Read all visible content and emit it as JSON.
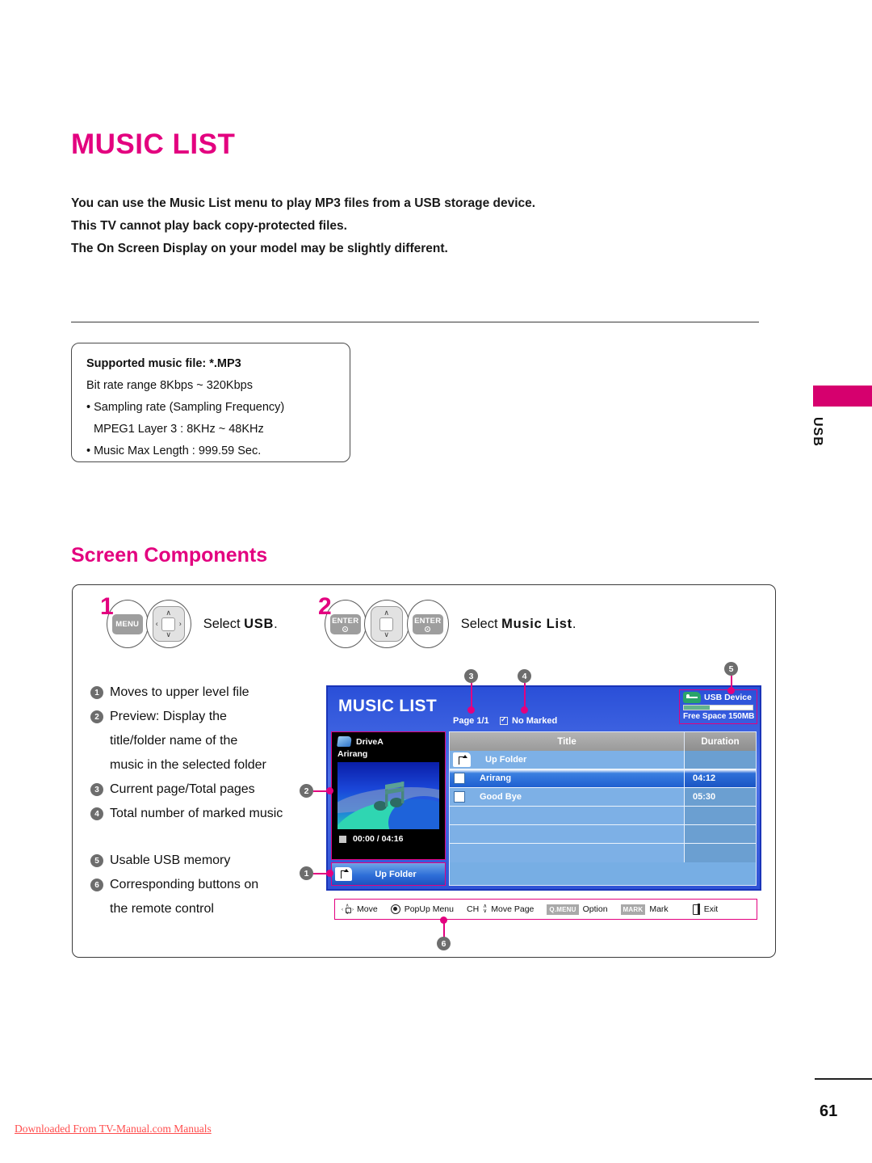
{
  "page": {
    "title": "MUSIC LIST",
    "number": "61",
    "download_note": "Downloaded From TV-Manual.com Manuals",
    "side_tab_label": "USB",
    "accent_color": "#e3007f"
  },
  "intro": {
    "lines": [
      "You can use the Music List menu to play MP3 files from a USB storage device.",
      "This TV cannot play back copy-protected files.",
      "The On Screen Display on your model may be slightly different."
    ]
  },
  "spec_box": {
    "heading": "Supported music file: *.MP3",
    "lines": [
      "Bit rate range 8Kbps ~ 320Kbps",
      "• Sampling rate (Sampling Frequency)",
      "MPEG1 Layer 3 : 8KHz ~ 48KHz",
      "• Music Max Length : 999.59 Sec."
    ]
  },
  "section": {
    "title": "Screen Components"
  },
  "steps": [
    {
      "number": "1",
      "keys": [
        "MENU",
        "navpad-4way"
      ],
      "key_label": "MENU",
      "text_prefix": "Select ",
      "text_bold": "USB",
      "text_suffix": "."
    },
    {
      "number": "2",
      "keys": [
        "ENTER",
        "navpad-updown",
        "ENTER"
      ],
      "key_label": "ENTER",
      "text_prefix": "Select ",
      "text_bold": "Music List",
      "text_suffix": "."
    }
  ],
  "legend": [
    {
      "num": "1",
      "text": "Moves to upper level file"
    },
    {
      "num": "2",
      "text": "Preview: Display the"
    },
    {
      "num": "",
      "text": "title/folder name of the"
    },
    {
      "num": "",
      "text": "music in the selected folder"
    },
    {
      "num": "3",
      "text": "Current page/Total pages"
    },
    {
      "num": "4",
      "text": "Total number of marked music"
    },
    {
      "num": "5",
      "text": "Usable USB memory"
    },
    {
      "num": "6",
      "text": "Corresponding buttons on"
    },
    {
      "num": "",
      "text": "the remote control"
    }
  ],
  "tv": {
    "title": "MUSIC LIST",
    "page_indicator": "Page 1/1",
    "marked_status": "No Marked",
    "usb_device_label": "USB Device",
    "free_space": "Free Space 150MB",
    "usb_bar_fill_percent": 38,
    "preview": {
      "drive": "DriveA",
      "track": "Arirang",
      "time": "00:00 / 04:16"
    },
    "up_folder_button": "Up Folder",
    "columns": [
      "Title",
      "Duration"
    ],
    "rows": [
      {
        "icon": "up-folder-icon",
        "title": "Up Folder",
        "duration": "",
        "selected": false
      },
      {
        "icon": "checkbox",
        "title": "Arirang",
        "duration": "04:12",
        "selected": true
      },
      {
        "icon": "checkbox",
        "title": "Good Bye",
        "duration": "05:30",
        "selected": false
      },
      {
        "icon": "",
        "title": "",
        "duration": "",
        "selected": false
      },
      {
        "icon": "",
        "title": "",
        "duration": "",
        "selected": false
      },
      {
        "icon": "",
        "title": "",
        "duration": "",
        "selected": false
      }
    ],
    "hints": [
      {
        "icon": "dpad-icon",
        "label": "Move"
      },
      {
        "icon": "enter-dot-icon",
        "label": "PopUp Menu"
      },
      {
        "icon": "ch-updown-icon",
        "label": "Move Page",
        "prefix": "CH"
      },
      {
        "icon": "qmenu-key",
        "key": "Q.MENU",
        "label": "Option"
      },
      {
        "icon": "mark-key",
        "key": "MARK",
        "label": "Mark"
      },
      {
        "icon": "exit-icon",
        "label": "Exit"
      }
    ]
  },
  "callouts": [
    {
      "num": "1"
    },
    {
      "num": "2"
    },
    {
      "num": "3"
    },
    {
      "num": "4"
    },
    {
      "num": "5"
    },
    {
      "num": "6"
    }
  ]
}
